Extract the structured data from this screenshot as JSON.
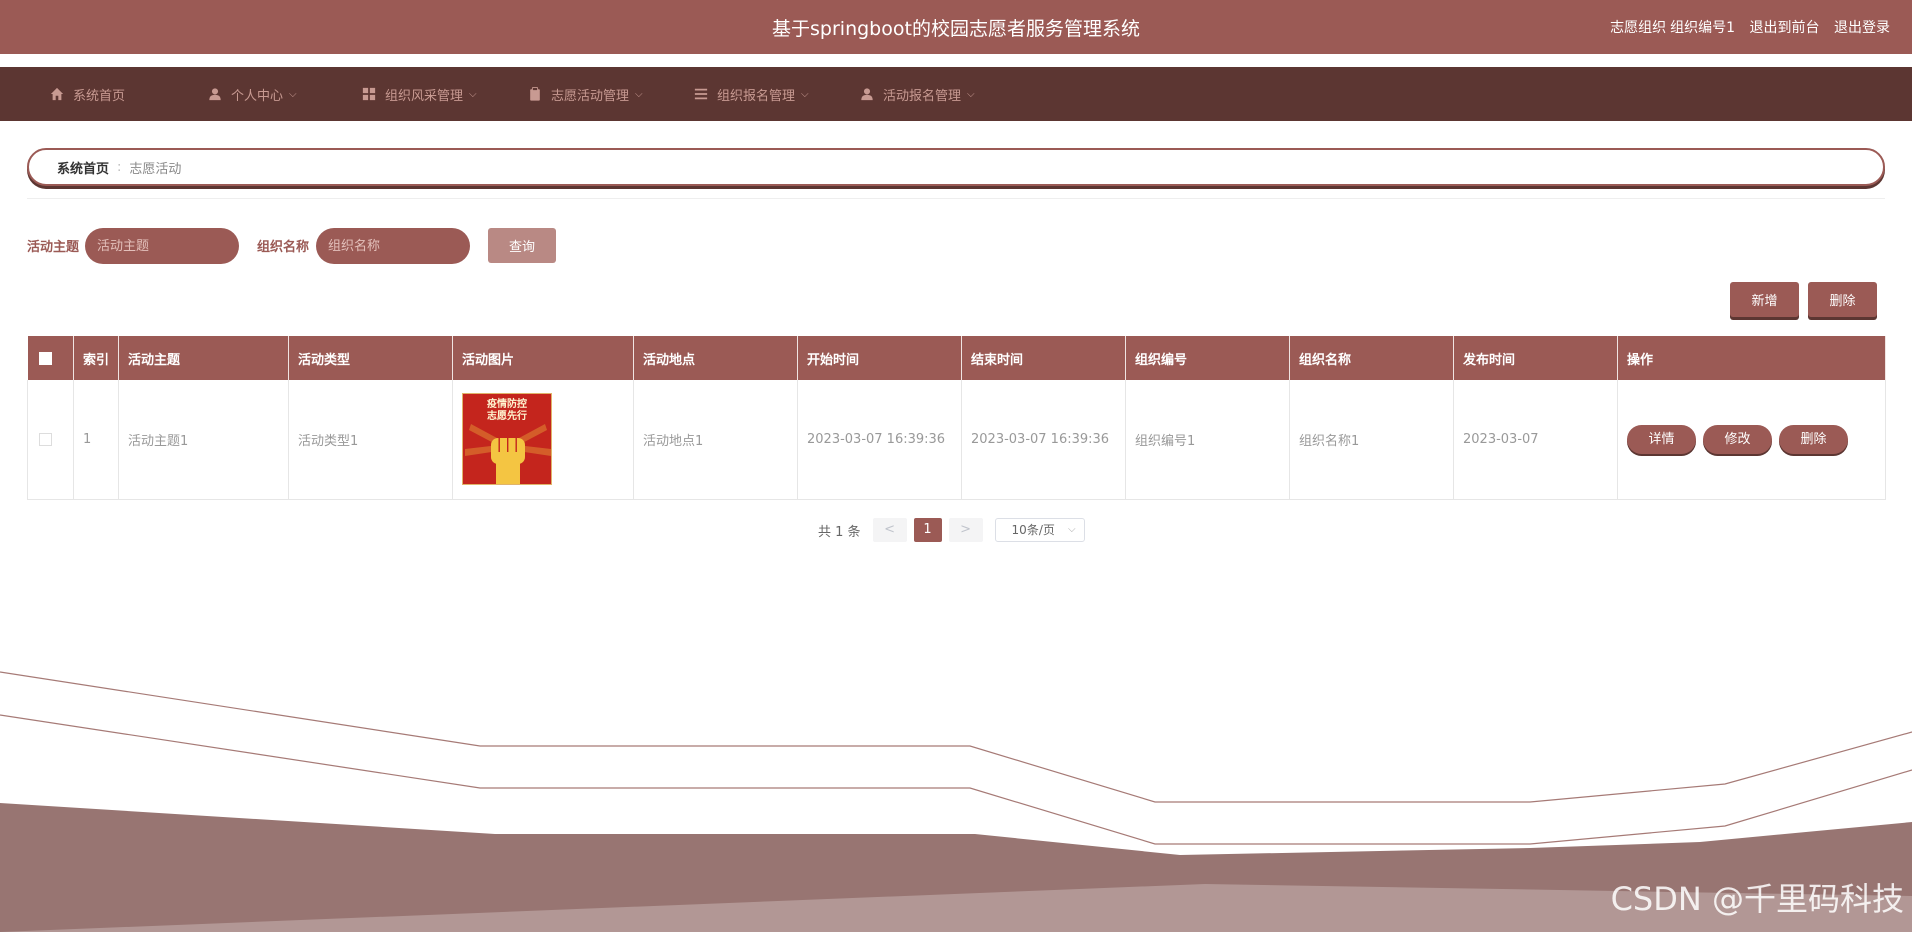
{
  "header": {
    "title": "基于springboot的校园志愿者服务管理系统",
    "role": "志愿组织",
    "user": "组织编号1",
    "to_front": "退出到前台",
    "logout": "退出登录"
  },
  "nav": [
    {
      "label": "系统首页",
      "icon": "home-icon"
    },
    {
      "label": "个人中心",
      "icon": "user-icon",
      "has_menu": true
    },
    {
      "label": "组织风采管理",
      "icon": "grid-icon",
      "has_menu": true
    },
    {
      "label": "志愿活动管理",
      "icon": "clipboard-icon",
      "has_menu": true
    },
    {
      "label": "组织报名管理",
      "icon": "list-icon",
      "has_menu": true
    },
    {
      "label": "活动报名管理",
      "icon": "user-icon",
      "has_menu": true
    }
  ],
  "breadcrumb": {
    "home": "系统首页",
    "sep": ":",
    "current": "志愿活动"
  },
  "search": {
    "theme_label": "活动主题",
    "theme_placeholder": "活动主题",
    "org_label": "组织名称",
    "org_placeholder": "组织名称",
    "query": "查询"
  },
  "toolbar": {
    "add": "新增",
    "delete": "删除"
  },
  "table": {
    "headers": [
      "索引",
      "活动主题",
      "活动类型",
      "活动图片",
      "活动地点",
      "开始时间",
      "结束时间",
      "组织编号",
      "组织名称",
      "发布时间",
      "操作"
    ],
    "rows": [
      {
        "index": "1",
        "theme": "活动主题1",
        "type": "活动类型1",
        "image_text": [
          "疫情防控",
          "志愿先行"
        ],
        "location": "活动地点1",
        "start": "2023-03-07 16:39:36",
        "end": "2023-03-07 16:39:36",
        "org_no": "组织编号1",
        "org_name": "组织名称1",
        "published": "2023-03-07"
      }
    ],
    "actions": {
      "detail": "详情",
      "edit": "修改",
      "delete": "删除"
    }
  },
  "pager": {
    "total": "共 1 条",
    "prev": "<",
    "current": "1",
    "next": ">",
    "page_size": "10条/页"
  },
  "watermark": "CSDN @千里码科技",
  "colors": {
    "primary": "#9b5a55",
    "nav_bg": "#5c3632",
    "light": "#b98984"
  }
}
